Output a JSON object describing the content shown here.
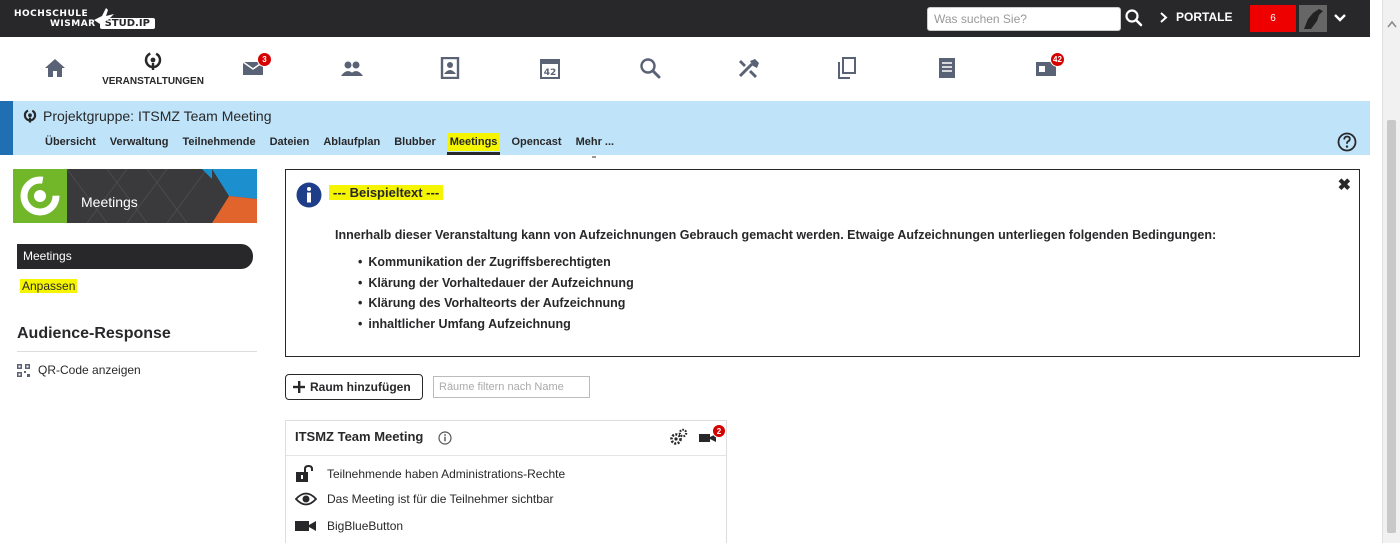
{
  "header": {
    "logo_line1": "HOCHSCHULE",
    "logo_line2": "WISMAR",
    "logo_studip": "STUD.IP",
    "search_placeholder": "Was suchen Sie?",
    "portale_label": "PORTALE",
    "notification_count": "6"
  },
  "mainnav": {
    "items": [
      {
        "name": "home",
        "icon": "home-icon"
      },
      {
        "name": "veranstaltungen",
        "icon": "courses-icon",
        "label": "VERANSTALTUNGEN"
      },
      {
        "name": "messages",
        "icon": "mail-icon",
        "badge": "3"
      },
      {
        "name": "community",
        "icon": "community-icon"
      },
      {
        "name": "profile",
        "icon": "profile-icon"
      },
      {
        "name": "schedule",
        "icon": "calendar-icon"
      },
      {
        "name": "search",
        "icon": "search-icon"
      },
      {
        "name": "tools",
        "icon": "tools-icon"
      },
      {
        "name": "files",
        "icon": "files-icon"
      },
      {
        "name": "resources",
        "icon": "list-icon"
      },
      {
        "name": "admin",
        "icon": "admin-icon",
        "badge": "42"
      }
    ]
  },
  "context": {
    "title": "Projektgruppe: ITSMZ Team Meeting",
    "tabs": [
      {
        "label": "Übersicht"
      },
      {
        "label": "Verwaltung"
      },
      {
        "label": "Teilnehmende"
      },
      {
        "label": "Dateien"
      },
      {
        "label": "Ablaufplan"
      },
      {
        "label": "Blubber"
      },
      {
        "label": "Meetings",
        "active": true
      },
      {
        "label": "Opencast"
      },
      {
        "label": "Mehr ..."
      }
    ]
  },
  "sidebar": {
    "banner_label": "Meetings",
    "nav_active": "Meetings",
    "nav_link": "Anpassen",
    "section_heading": "Audience-Response",
    "qr_label": "QR-Code anzeigen"
  },
  "infobox": {
    "title": "--- Beispieltext ---",
    "text": "Innerhalb dieser Veranstaltung kann von Aufzeichnungen Gebrauch gemacht werden. Etwaige Aufzeichnungen unterliegen folgenden Bedingungen:",
    "items": [
      "Kommunikation der Zugriffsberechtigten",
      "Klärung der Vorhaltedauer der Aufzeichnung",
      "Klärung des Vorhalteorts der Aufzeichnung",
      "inhaltlicher Umfang Aufzeichnung"
    ]
  },
  "rooms": {
    "add_button": "Raum hinzufügen",
    "filter_placeholder": "Räume filtern nach Name",
    "room": {
      "name": "ITSMZ Team Meeting",
      "recordings_badge": "2",
      "rows": [
        {
          "icon": "unlock-icon",
          "text": "Teilnehmende haben Administrations-Rechte"
        },
        {
          "icon": "eye-icon",
          "text": "Das Meeting ist für die Teilnehmer sichtbar"
        },
        {
          "icon": "video-camera-icon",
          "text": "BigBlueButton"
        }
      ]
    }
  },
  "colors": {
    "topbar": "#28282a",
    "contextbar": "#bfe4f9",
    "highlight": "#f5f500",
    "badge": "#d60000",
    "notification": "#ee0000",
    "banner_green": "#72b62a"
  }
}
